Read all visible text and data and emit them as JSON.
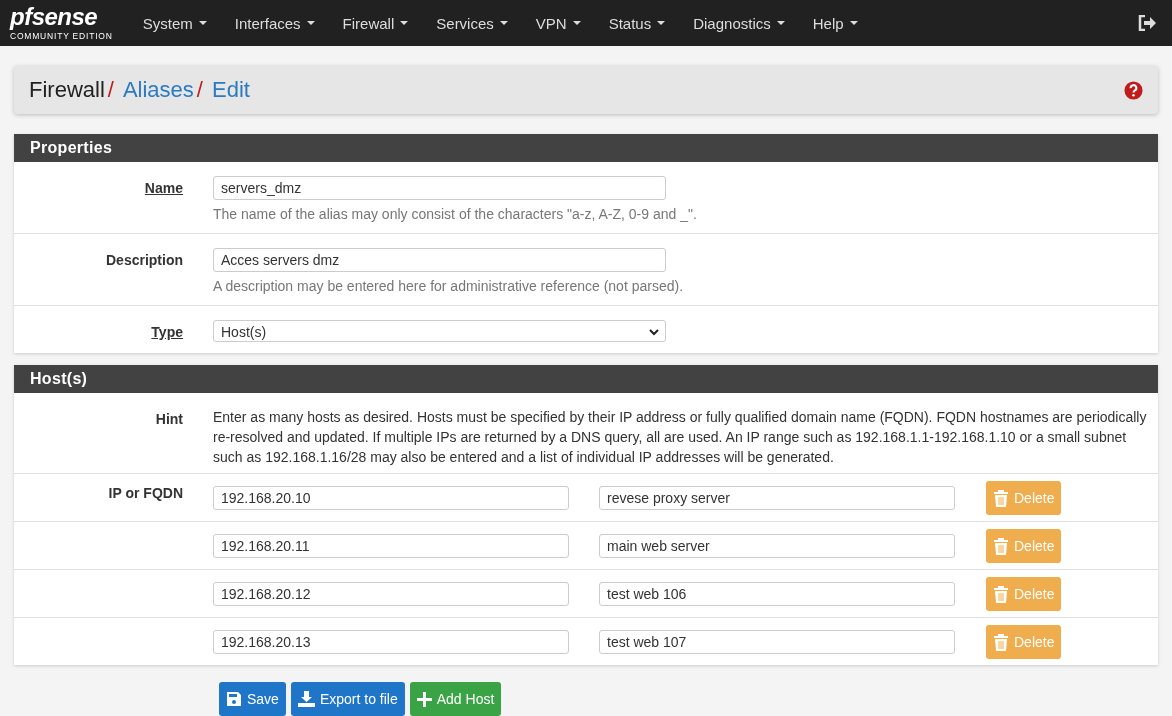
{
  "brand": {
    "logo": "pfsense",
    "subtitle": "COMMUNITY EDITION"
  },
  "menu": [
    "System",
    "Interfaces",
    "Firewall",
    "Services",
    "VPN",
    "Status",
    "Diagnostics",
    "Help"
  ],
  "breadcrumb": [
    {
      "label": "Firewall",
      "link": false,
      "separator": "/"
    },
    {
      "label": "Aliases",
      "link": true,
      "separator": "/"
    },
    {
      "label": "Edit",
      "link": true
    }
  ],
  "properties": {
    "title": "Properties",
    "rows": [
      {
        "label": "Name",
        "required": true,
        "kind": "input",
        "value": "servers_dmz",
        "help": "The name of the alias may only consist of the characters \"a-z, A-Z, 0-9 and _\"."
      },
      {
        "label": "Description",
        "required": false,
        "kind": "input",
        "value": "Acces servers dmz",
        "help": "A description may be entered here for administrative reference (not parsed)."
      },
      {
        "label": "Type",
        "required": true,
        "kind": "select",
        "value": "Host(s)"
      }
    ]
  },
  "hosts": {
    "title": "Host(s)",
    "hint_label": "Hint",
    "hint": "Enter as many hosts as desired. Hosts must be specified by their IP address or fully qualified domain name (FQDN). FQDN hostnames are periodically re-resolved and updated. If multiple IPs are returned by a DNS query, all are used. An IP range such as 192.168.1.1-192.168.1.10 or a small subnet such as 192.168.1.16/28 may also be entered and a list of individual IP addresses will be generated.",
    "rows_label": "IP or FQDN",
    "rows": [
      {
        "address": "192.168.20.10",
        "description": "revese proxy server",
        "delete_label": "Delete"
      },
      {
        "address": "192.168.20.11",
        "description": "main web server",
        "delete_label": "Delete"
      },
      {
        "address": "192.168.20.12",
        "description": "test web 106",
        "delete_label": "Delete"
      },
      {
        "address": "192.168.20.13",
        "description": "test web 107",
        "delete_label": "Delete"
      }
    ]
  },
  "buttons": [
    {
      "kind": "save",
      "label": "Save"
    },
    {
      "kind": "export",
      "label": "Export to file"
    },
    {
      "kind": "add",
      "label": "Add Host"
    }
  ]
}
